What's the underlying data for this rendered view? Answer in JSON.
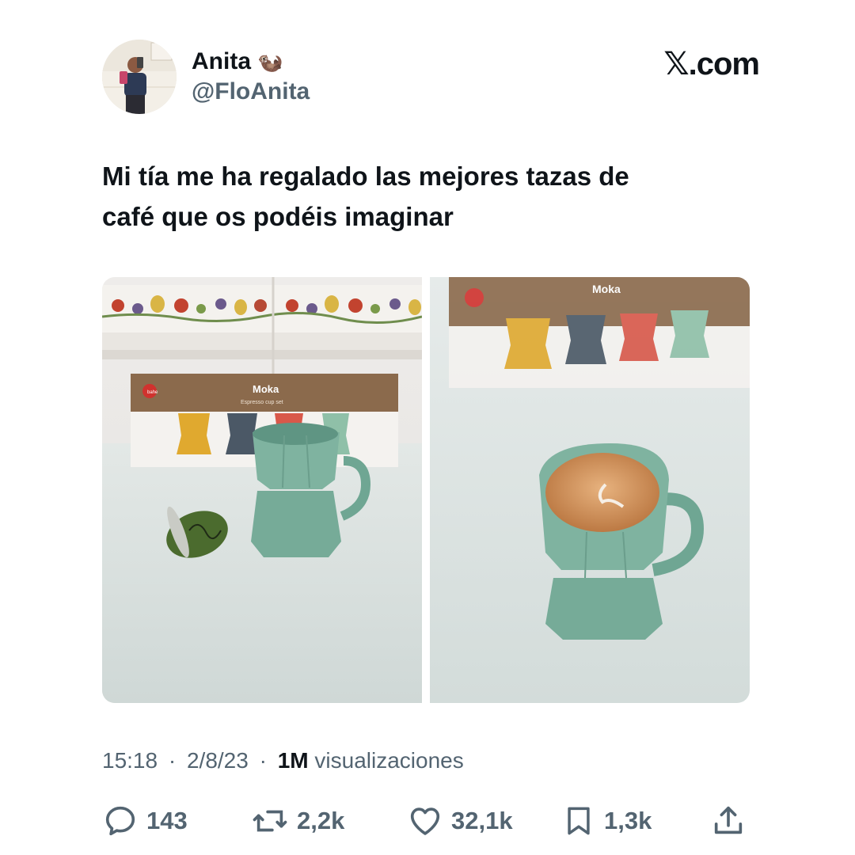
{
  "tweet": {
    "author": {
      "display_name": "Anita",
      "name_emoji": "🦦",
      "handle": "@FloAnita"
    },
    "site": "𝕏.com",
    "text_line1": "Mi tía me ha regalado las mejores tazas de",
    "text_line2": "café que os podéis imaginar",
    "photos": {
      "box_brand": "Moka",
      "box_subtitle": "Espresso cup set",
      "logo_text": "bahe"
    },
    "meta": {
      "time": "15:18",
      "date": "2/8/23",
      "views_count": "1M",
      "views_label": "visualizaciones",
      "separator": "·"
    },
    "actions": {
      "replies": "143",
      "reposts": "2,2k",
      "likes": "32,1k",
      "bookmarks": "1,3k"
    }
  },
  "colors": {
    "text": "#0f1419",
    "secondary": "#536471",
    "cup_green": "#7fb3a0",
    "box_brown": "#8b6a4c"
  }
}
